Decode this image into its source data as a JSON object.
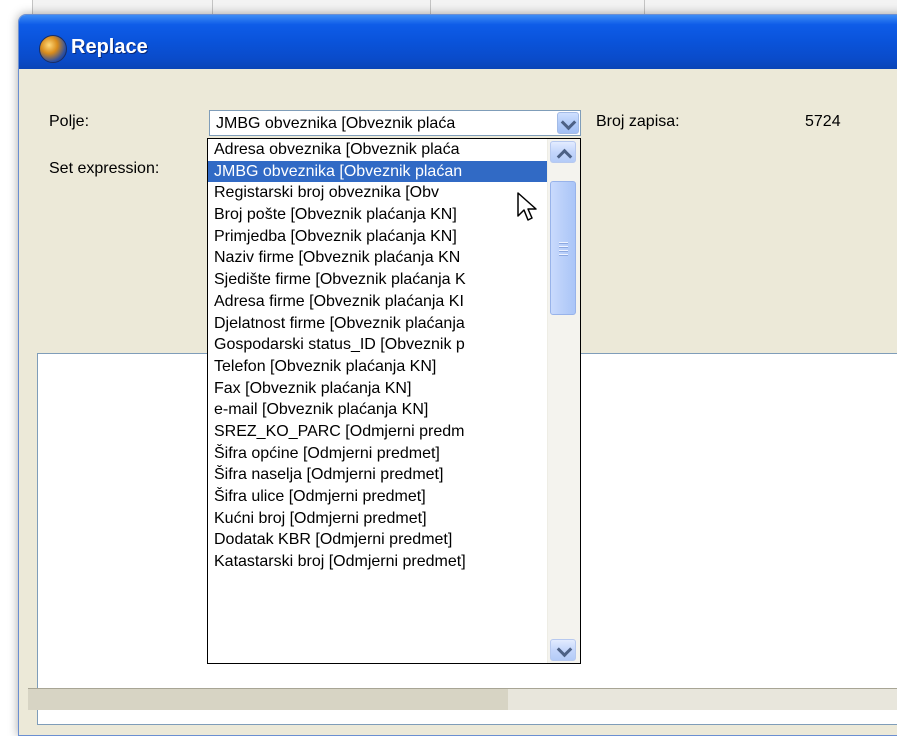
{
  "dialog": {
    "title": "Replace",
    "polje_label": "Polje:",
    "polje_value": "JMBG obveznika [Obveznik plaća",
    "broj_zapisa_label": "Broj zapisa:",
    "broj_zapisa_value": "5724",
    "set_expression_label": "Set expression:"
  },
  "dropdown": {
    "selected_index": 1,
    "items": [
      "Adresa obveznika [Obveznik plaća",
      "JMBG obveznika [Obveznik plaćan",
      "Registarski broj obveznika [Obv",
      "Broj pošte [Obveznik plaćanja KN]",
      "Primjedba [Obveznik plaćanja KN]",
      "Naziv firme [Obveznik plaćanja KN",
      "Sjedište firme [Obveznik plaćanja K",
      "Adresa firme [Obveznik plaćanja KI",
      "Djelatnost firme [Obveznik plaćanja",
      "Gospodarski status_ID [Obveznik p",
      "Telefon [Obveznik plaćanja KN]",
      "Fax [Obveznik plaćanja KN]",
      "e-mail [Obveznik plaćanja KN]",
      "SREZ_KO_PARC [Odmjerni predm",
      "Šifra općine [Odmjerni predmet]",
      "Šifra naselja [Odmjerni predmet]",
      "Šifra ulice [Odmjerni predmet]",
      "Kućni broj [Odmjerni predmet]",
      "Dodatak KBR [Odmjerni predmet]",
      "Katastarski broj [Odmjerni predmet]"
    ]
  },
  "icons": {
    "app": "globe-icon",
    "dropdown_arrow": "chevron-down-icon",
    "scroll_up": "chevron-up-icon",
    "scroll_down": "chevron-down-icon",
    "pointer": "mouse-cursor-icon"
  },
  "colors": {
    "titlebar": "#0a53da",
    "selection": "#316ac5",
    "dialog_bg": "#ece9d8"
  }
}
